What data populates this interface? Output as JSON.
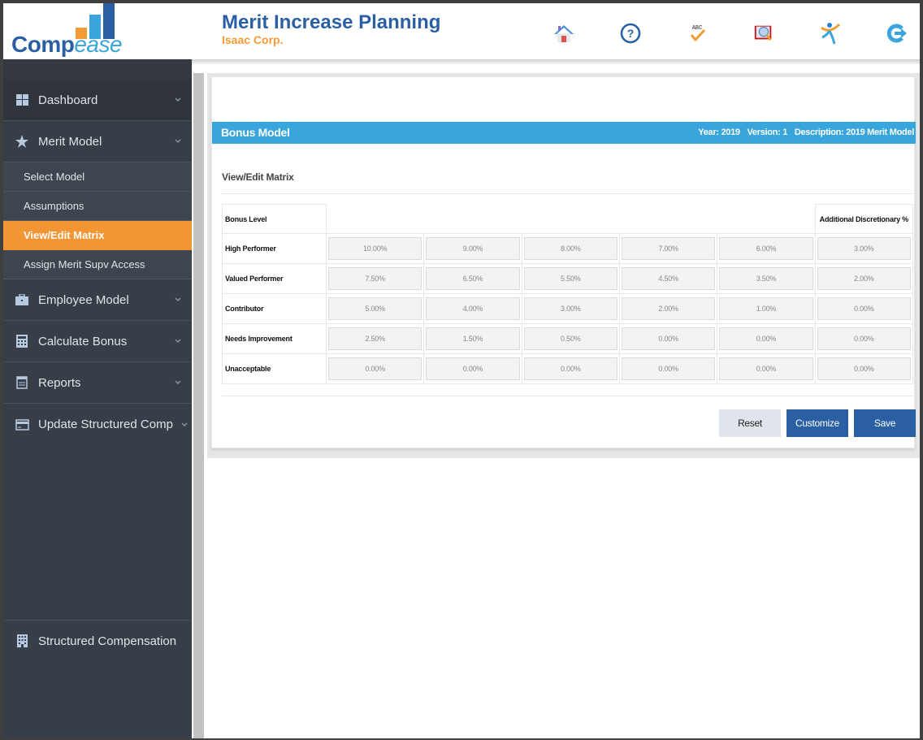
{
  "header": {
    "logo": {
      "part1": "Comp",
      "part2": "ease"
    },
    "title": "Merit Increase Planning",
    "company": "Isaac Corp.",
    "icons": [
      "home-icon",
      "help-icon",
      "spellcheck-icon",
      "search-book-icon",
      "user-activity-icon",
      "logout-icon"
    ]
  },
  "sidebar": {
    "items": [
      {
        "label": "Dashboard",
        "icon": "dashboard-icon"
      },
      {
        "label": "Merit Model",
        "icon": "star-icon"
      },
      {
        "label": "Employee Model",
        "icon": "briefcase-icon"
      },
      {
        "label": "Calculate Bonus",
        "icon": "calculator-icon"
      },
      {
        "label": "Reports",
        "icon": "report-icon"
      },
      {
        "label": "Update Structured Comp",
        "icon": "card-icon"
      }
    ],
    "subitems": [
      {
        "label": "Select Model",
        "active": false
      },
      {
        "label": "Assumptions",
        "active": false
      },
      {
        "label": "View/Edit Matrix",
        "active": true
      },
      {
        "label": "Assign Merit Supv Access",
        "active": false
      }
    ],
    "bottom": {
      "label": "Structured Compensation",
      "icon": "building-icon"
    }
  },
  "panel": {
    "title": "Bonus Model",
    "year": "Year: 2019",
    "version": "Version: 1",
    "description": "Description: 2019 Merit Model",
    "section_title": "View/Edit Matrix"
  },
  "matrix": {
    "header_label": "Bonus Level",
    "discretionary_header": "Additional Discretionary %",
    "rows": [
      {
        "label": "High Performer",
        "values": [
          "10.00%",
          "9.00%",
          "8.00%",
          "7.00%",
          "6.00%",
          "3.00%"
        ]
      },
      {
        "label": "Valued Performer",
        "values": [
          "7.50%",
          "6.50%",
          "5.50%",
          "4.50%",
          "3.50%",
          "2.00%"
        ]
      },
      {
        "label": "Contributor",
        "values": [
          "5.00%",
          "4.00%",
          "3.00%",
          "2.00%",
          "1.00%",
          "0.00%"
        ]
      },
      {
        "label": "Needs Improvement",
        "values": [
          "2.50%",
          "1.50%",
          "0.50%",
          "0.00%",
          "0.00%",
          "0.00%"
        ]
      },
      {
        "label": "Unacceptable",
        "values": [
          "0.00%",
          "0.00%",
          "0.00%",
          "0.00%",
          "0.00%",
          "0.00%"
        ]
      }
    ]
  },
  "buttons": {
    "reset": "Reset",
    "customize": "Customize",
    "save": "Save"
  },
  "colors": {
    "brand_blue": "#2a5fa3",
    "accent_orange": "#f39532",
    "header_bar": "#38a5dc",
    "sidebar_bg": "#383e47"
  }
}
